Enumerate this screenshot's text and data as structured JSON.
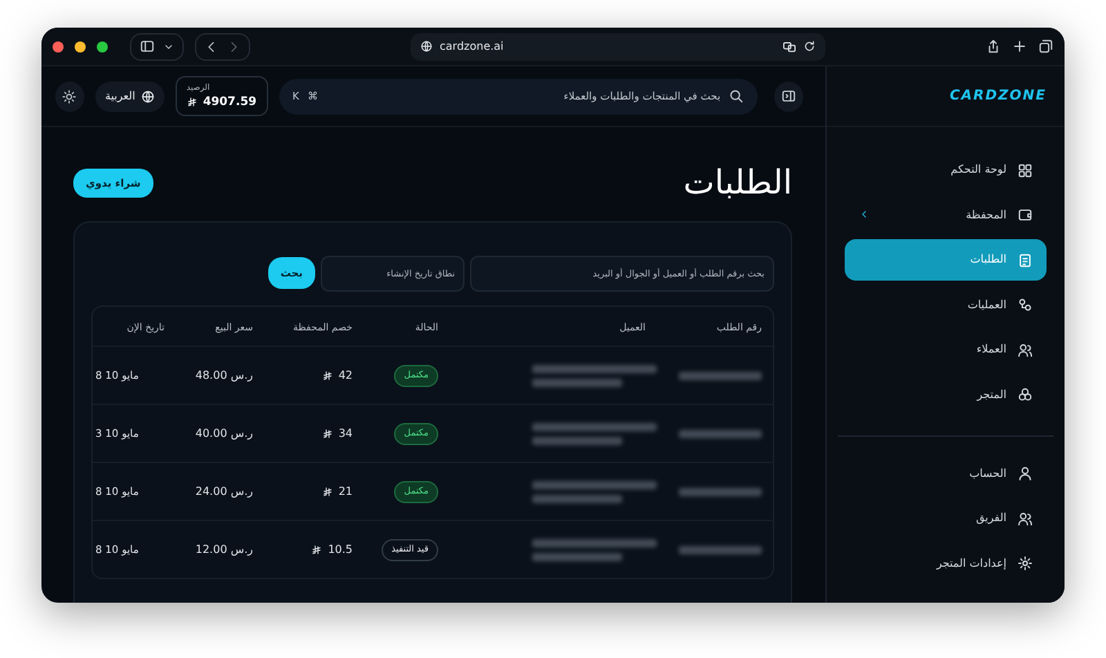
{
  "browser": {
    "url": "cardzone.ai"
  },
  "sidebar": {
    "logo": "CARDZONE",
    "items": [
      {
        "label": "لوحة التحكم",
        "selected": false,
        "expandable": false
      },
      {
        "label": "المحفظة",
        "selected": false,
        "expandable": true
      },
      {
        "label": "الطلبات",
        "selected": true,
        "expandable": false
      },
      {
        "label": "العمليات",
        "selected": false,
        "expandable": false
      },
      {
        "label": "العملاء",
        "selected": false,
        "expandable": false
      },
      {
        "label": "المتجر",
        "selected": false,
        "expandable": false
      }
    ],
    "settings_items": [
      {
        "label": "الحساب",
        "selected": false
      },
      {
        "label": "الفريق",
        "selected": false
      },
      {
        "label": "إعدادات المتجر",
        "selected": false
      }
    ]
  },
  "header": {
    "search": {
      "placeholder": "بحث في المنتجات والطلبات والعملاء",
      "shortcut": [
        "⌘",
        "K"
      ]
    },
    "balance": {
      "label": "الرصيد",
      "amount": "4907.59"
    },
    "language": "العربية"
  },
  "page": {
    "title": "الطلبات",
    "action": "شراء يدوي",
    "filters": {
      "search_placeholder": "بحث برقم الطلب أو العميل أو الجوال أو البريد",
      "date_placeholder": "نطاق تاريخ الإنشاء",
      "button": "بحث"
    },
    "table": {
      "columns": [
        "رقم الطلب",
        "العميل",
        "الحالة",
        "خصم المحفظة",
        "سعر البيع",
        "تاريخ الإن"
      ],
      "rows": [
        {
          "status": "مكتمل",
          "kind": "completed",
          "wallet_discount": "42",
          "price": "ر.س 48.00",
          "date": "8 10 مايو"
        },
        {
          "status": "مكتمل",
          "kind": "completed",
          "wallet_discount": "34",
          "price": "ر.س 40.00",
          "date": "3 10 مايو"
        },
        {
          "status": "مكتمل",
          "kind": "completed",
          "wallet_discount": "21",
          "price": "ر.س 24.00",
          "date": "8 10 مايو"
        },
        {
          "status": "قيد التنفيذ",
          "kind": "pending",
          "wallet_discount": "10.5",
          "price": "ر.س 12.00",
          "date": "8 10 مايو"
        }
      ]
    }
  }
}
